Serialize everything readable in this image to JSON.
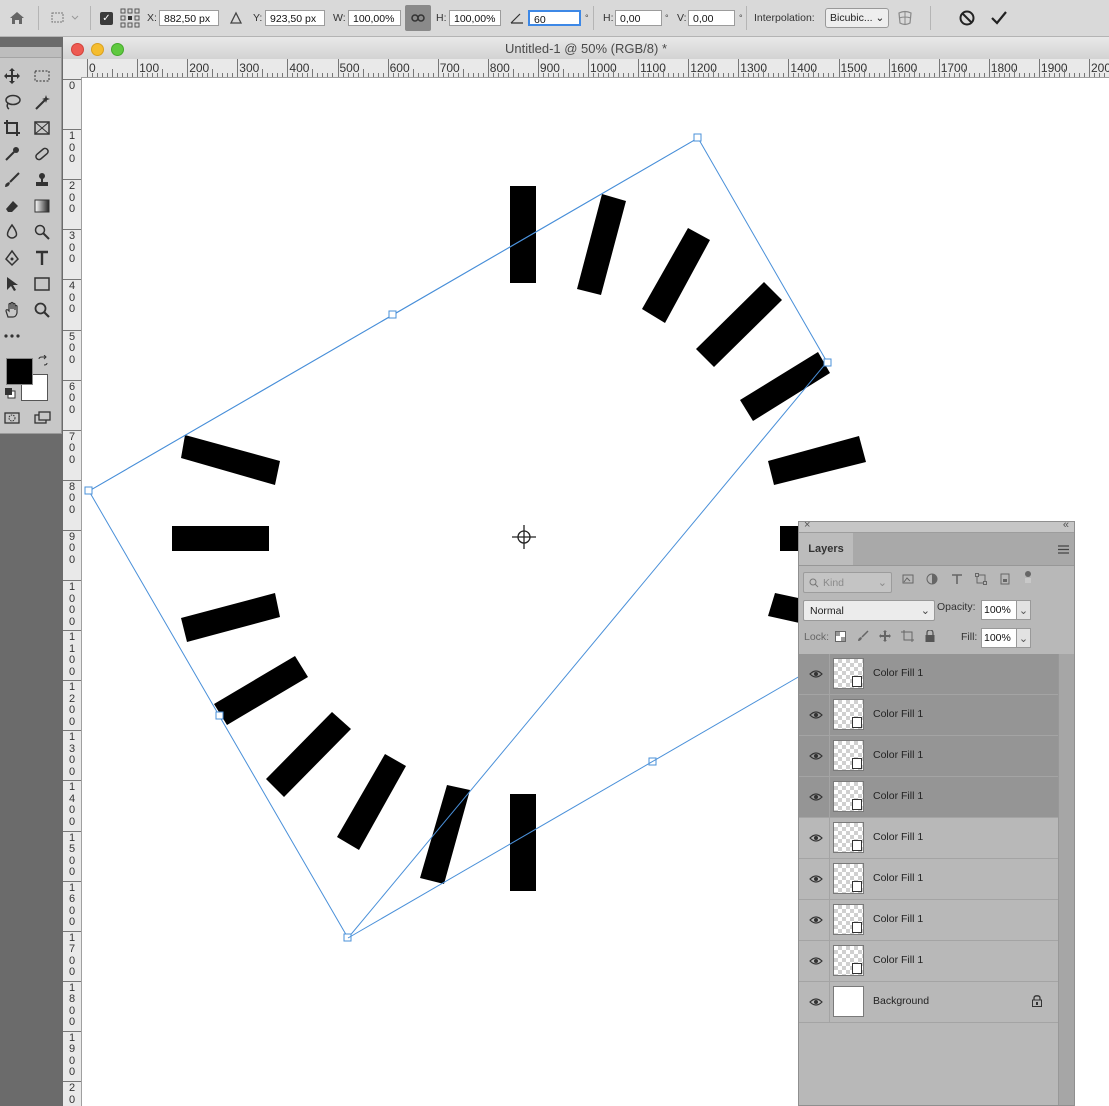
{
  "options_bar": {
    "x_label": "X:",
    "x_value": "882,50 px",
    "y_label": "Y:",
    "y_value": "923,50 px",
    "w_label": "W:",
    "w_value": "100,00%",
    "h_label": "H:",
    "h_value": "100,00%",
    "angle_value": "60",
    "angle_unit": "°",
    "skew_h_label": "H:",
    "skew_h_value": "0,00",
    "skew_h_unit": "°",
    "skew_v_label": "V:",
    "skew_v_value": "0,00",
    "skew_v_unit": "°",
    "interpolation_label": "Interpolation:",
    "interpolation_value": "Bicubic..."
  },
  "document": {
    "title": "Untitled-1 @ 50% (RGB/8) *"
  },
  "rulers": {
    "horizontal": [
      "0",
      "100",
      "200",
      "300",
      "400",
      "500",
      "600",
      "700",
      "800",
      "900",
      "1000",
      "1100",
      "1200",
      "1300",
      "1400",
      "1500",
      "1600",
      "1700",
      "1800",
      "1900",
      "200"
    ],
    "vertical": [
      "0",
      "100",
      "200",
      "300",
      "400",
      "500",
      "600",
      "700",
      "800",
      "900",
      "1000",
      "1100",
      "1200",
      "1300",
      "1400",
      "1500",
      "1600",
      "1700",
      "1800",
      "1900",
      "20"
    ]
  },
  "layers_panel": {
    "tab_label": "Layers",
    "filter_placeholder": "Kind",
    "blend_mode": "Normal",
    "opacity_label": "Opacity:",
    "opacity_value": "100%",
    "lock_label": "Lock:",
    "fill_label": "Fill:",
    "fill_value": "100%",
    "layers": [
      {
        "name": "Color Fill 1",
        "selected": true
      },
      {
        "name": "Color Fill 1",
        "selected": true
      },
      {
        "name": "Color Fill 1",
        "selected": true
      },
      {
        "name": "Color Fill 1",
        "selected": true
      },
      {
        "name": "Color Fill 1",
        "selected": false
      },
      {
        "name": "Color Fill 1",
        "selected": false
      },
      {
        "name": "Color Fill 1",
        "selected": false
      },
      {
        "name": "Color Fill 1",
        "selected": false
      },
      {
        "name": "Background",
        "selected": false,
        "locked": true
      }
    ]
  },
  "colors": {
    "foreground": "#000000",
    "background": "#ffffff",
    "selection_blue": "#3d88e6",
    "transform_box": "#4a90d9"
  }
}
